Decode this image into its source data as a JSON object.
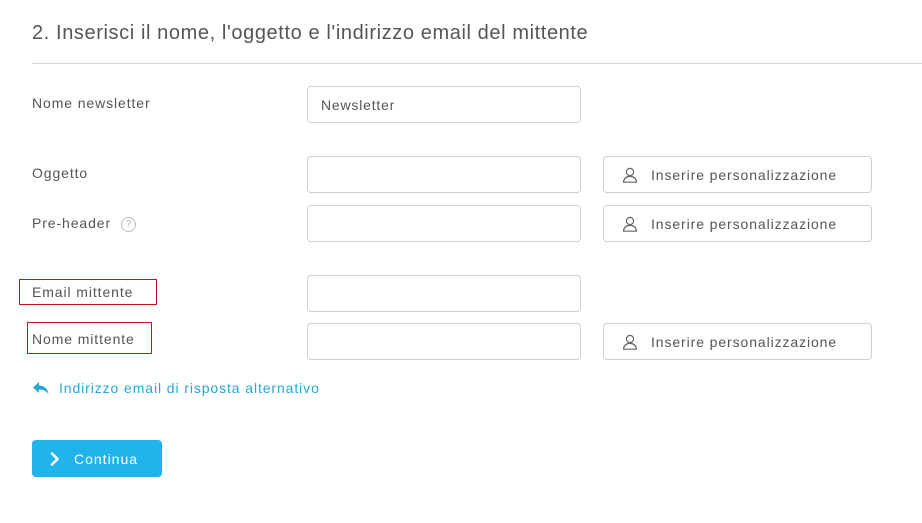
{
  "section": {
    "title": "2. Inserisci il nome, l'oggetto e l'indirizzo email del mittente"
  },
  "fields": {
    "newsletter_name": {
      "label": "Nome newsletter",
      "value": "Newsletter"
    },
    "subject": {
      "label": "Oggetto",
      "value": ""
    },
    "preheader": {
      "label": "Pre-header",
      "value": "",
      "help_icon": "?"
    },
    "sender_email": {
      "label": "Email mittente",
      "value": ""
    },
    "sender_name": {
      "label": "Nome mittente",
      "value": ""
    }
  },
  "personalization_button_label": "Inserire personalizzazione",
  "reply_link_label": "Indirizzo email di risposta alternativo",
  "continue_button_label": "Continua",
  "icons": {
    "personalization": "user-icon",
    "reply": "reply-arrow-icon",
    "continue": "chevron-right-icon"
  },
  "colors": {
    "accent": "#1fb5ec",
    "link": "#26a7d8",
    "highlight_border": "#c0161c",
    "text": "#555555",
    "input_border": "#cfcfcf"
  }
}
